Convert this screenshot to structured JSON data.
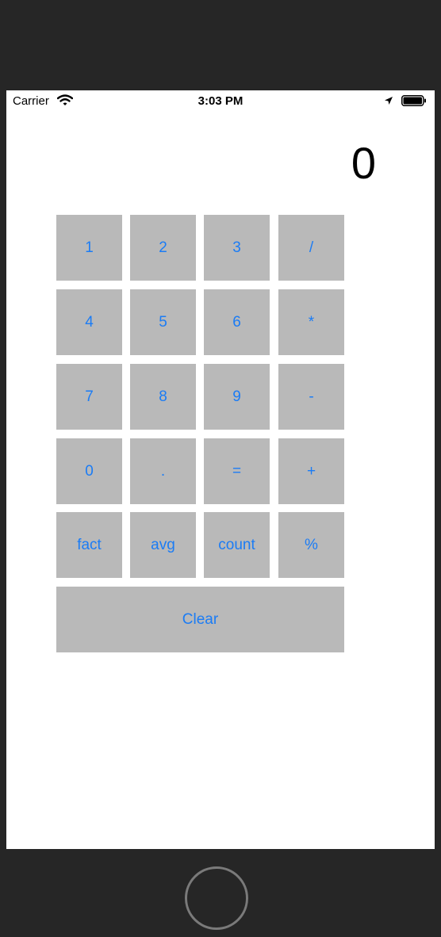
{
  "status_bar": {
    "carrier": "Carrier",
    "time": "3:03 PM",
    "icons": [
      "wifi-icon",
      "location-arrow-icon",
      "battery-icon"
    ]
  },
  "display": {
    "value": "0"
  },
  "keys": [
    [
      "1",
      "2",
      "3",
      "/"
    ],
    [
      "4",
      "5",
      "6",
      "*"
    ],
    [
      "7",
      "8",
      "9",
      "-"
    ],
    [
      "0",
      ".",
      "=",
      "+"
    ],
    [
      "fact",
      "avg",
      "count",
      "%"
    ]
  ],
  "clear_label": "Clear",
  "colors": {
    "key_background": "#b9b9b9",
    "key_text": "#1b7cf5",
    "screen": "#ffffff",
    "device_frame": "#262626"
  }
}
